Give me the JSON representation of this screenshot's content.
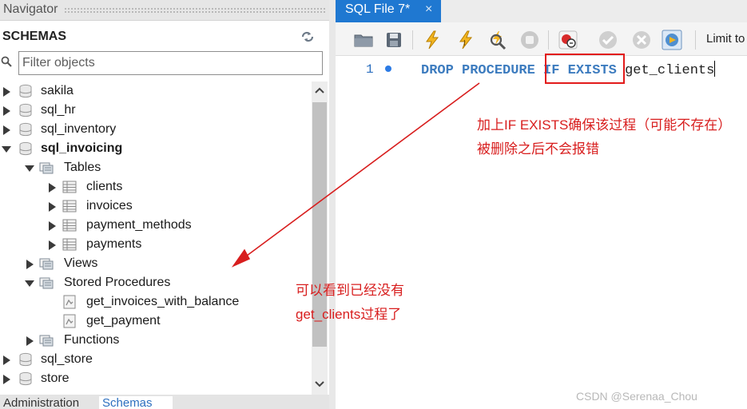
{
  "navigator": {
    "title": "Navigator",
    "schemas_title": "SCHEMAS",
    "filter_placeholder": "Filter objects",
    "tree": [
      {
        "label": "sakila",
        "kind": "schema",
        "expanded": false
      },
      {
        "label": "sql_hr",
        "kind": "schema",
        "expanded": false
      },
      {
        "label": "sql_inventory",
        "kind": "schema",
        "expanded": false
      },
      {
        "label": "sql_invoicing",
        "kind": "schema",
        "expanded": true
      },
      {
        "label": "Tables",
        "kind": "folder",
        "expanded": true
      },
      {
        "label": "clients",
        "kind": "table"
      },
      {
        "label": "invoices",
        "kind": "table"
      },
      {
        "label": "payment_methods",
        "kind": "table"
      },
      {
        "label": "payments",
        "kind": "table"
      },
      {
        "label": "Views",
        "kind": "folder",
        "expanded": false
      },
      {
        "label": "Stored Procedures",
        "kind": "folder",
        "expanded": true
      },
      {
        "label": "get_invoices_with_balance",
        "kind": "procedure"
      },
      {
        "label": "get_payment",
        "kind": "procedure"
      },
      {
        "label": "Functions",
        "kind": "folder",
        "expanded": false
      },
      {
        "label": "sql_store",
        "kind": "schema",
        "expanded": false
      },
      {
        "label": "store",
        "kind": "schema",
        "expanded": false
      }
    ],
    "bottom_tabs": {
      "administration": "Administration",
      "schemas": "Schemas"
    }
  },
  "editor": {
    "tab_label": "SQL File 7*",
    "tab_close": "×",
    "toolbar": {
      "limit_label": "Limit to"
    },
    "line_number": "1",
    "code": {
      "kw1": "DROP",
      "kw2": "PROCEDURE",
      "kw3": "IF",
      "kw4": "EXISTS",
      "name": "get_clients"
    }
  },
  "annotations": {
    "top": "加上IF EXISTS确保该过程（可能不存在）被删除之后不会报错",
    "bottom": "可以看到已经没有get_clients过程了"
  },
  "watermark": "CSDN @Serenaa_Chou",
  "colors": {
    "accent": "#1f78d1",
    "annotation": "#d81e1e",
    "keyword": "#3d7cbf"
  }
}
